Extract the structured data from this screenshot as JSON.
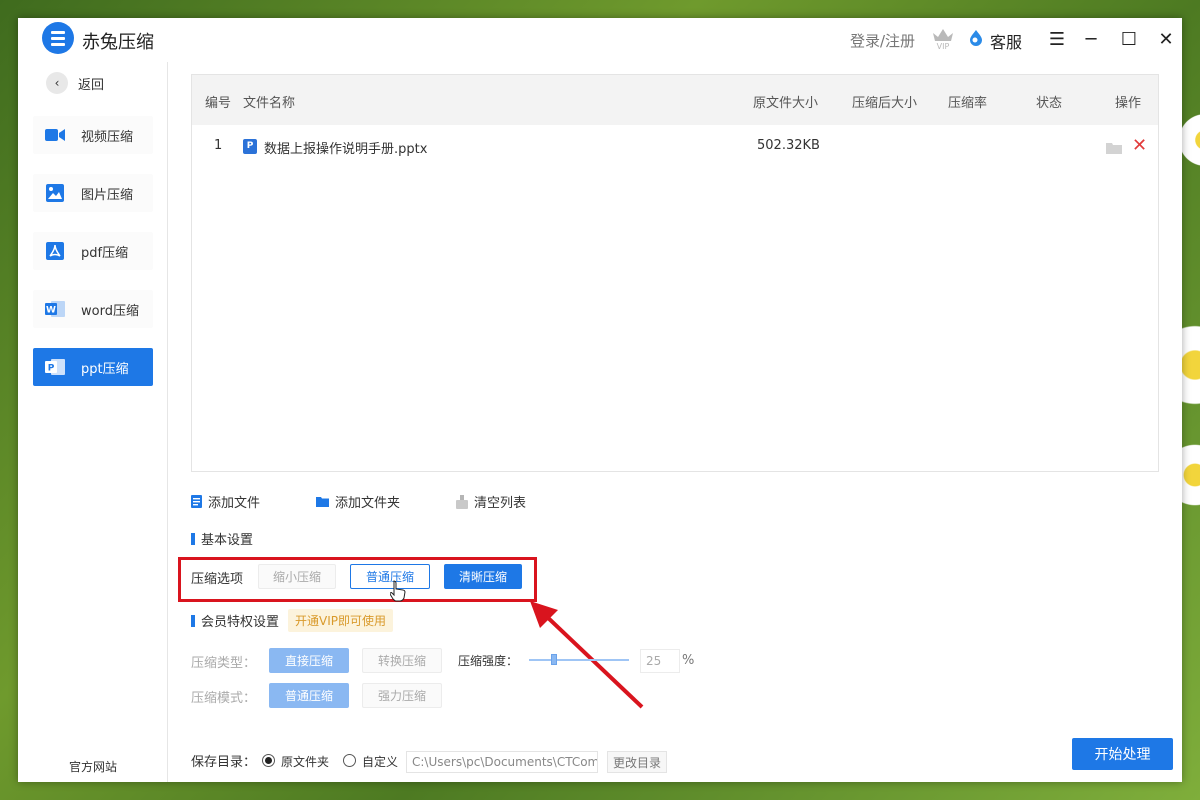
{
  "app": {
    "title": "赤兔压缩",
    "login": "登录/注册",
    "service": "客服"
  },
  "colors": {
    "accent": "#1e78e6",
    "delete": "#e23b3b",
    "highlight_box": "#d9141e",
    "vip_tag_text": "#d99a2b"
  },
  "sidebar": {
    "back": "返回",
    "items": [
      {
        "label": "视频压缩",
        "icon": "video-icon",
        "active": false
      },
      {
        "label": "图片压缩",
        "icon": "image-icon",
        "active": false
      },
      {
        "label": "pdf压缩",
        "icon": "pdf-icon",
        "active": false
      },
      {
        "label": "word压缩",
        "icon": "word-icon",
        "active": false
      },
      {
        "label": "ppt压缩",
        "icon": "ppt-icon",
        "active": true
      }
    ],
    "footer": "官方网站"
  },
  "table": {
    "headers": [
      "编号",
      "文件名称",
      "原文件大小",
      "压缩后大小",
      "压缩率",
      "状态",
      "操作"
    ],
    "rows": [
      {
        "index": "1",
        "name": "数据上报操作说明手册.pptx",
        "orig_size": "502.32KB",
        "new_size": "",
        "ratio": "",
        "status": ""
      }
    ]
  },
  "file_toolbar": {
    "add_file": "添加文件",
    "add_folder": "添加文件夹",
    "clear": "清空列表"
  },
  "basic_settings": {
    "title": "基本设置",
    "option_label": "压缩选项",
    "options": [
      "缩小压缩",
      "普通压缩",
      "清晰压缩"
    ],
    "selected": "清晰压缩"
  },
  "vip_settings": {
    "title": "会员特权设置",
    "tag": "开通VIP即可使用",
    "type_label": "压缩类型：",
    "types": [
      "直接压缩",
      "转换压缩"
    ],
    "strength_label": "压缩强度：",
    "strength_value": "25",
    "strength_unit": "%",
    "mode_label": "压缩模式：",
    "modes": [
      "普通压缩",
      "强力压缩"
    ]
  },
  "save": {
    "label": "保存目录：",
    "original_folder": "原文件夹",
    "custom": "自定义",
    "path": "C:\\Users\\pc\\Documents\\CTCom",
    "change": "更改目录",
    "selected": "原文件夹"
  },
  "start_button": "开始处理"
}
